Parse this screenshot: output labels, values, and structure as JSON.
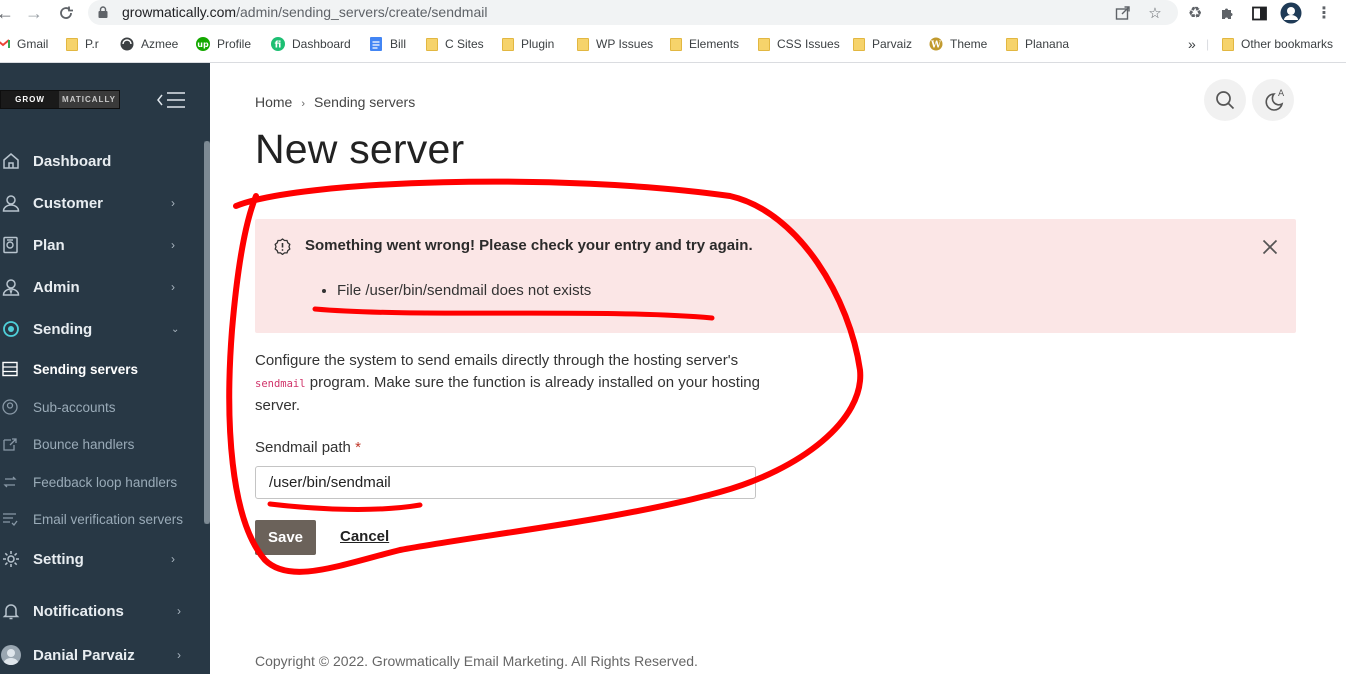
{
  "browser": {
    "url_host": "growmatically.com",
    "url_path": "/admin/sending_servers/create/sendmail",
    "bookmarks": [
      {
        "label": "Gmail",
        "icon": "gmail-icon"
      },
      {
        "label": "P.r",
        "icon": "folder-icon"
      },
      {
        "label": "Azmee",
        "icon": "globe-icon"
      },
      {
        "label": "Profile",
        "icon": "upwork-icon"
      },
      {
        "label": "Dashboard",
        "icon": "fiverr-icon"
      },
      {
        "label": "Bill",
        "icon": "docs-icon"
      },
      {
        "label": "C Sites",
        "icon": "folder-icon"
      },
      {
        "label": "Plugin",
        "icon": "folder-icon"
      },
      {
        "label": "WP Issues",
        "icon": "folder-icon"
      },
      {
        "label": "Elements",
        "icon": "folder-icon"
      },
      {
        "label": "CSS Issues",
        "icon": "folder-icon"
      },
      {
        "label": "Parvaiz",
        "icon": "folder-icon"
      },
      {
        "label": "Theme",
        "icon": "wordpress-icon"
      },
      {
        "label": "Planana",
        "icon": "folder-icon"
      }
    ],
    "overflow_label": "»",
    "other_bookmarks": "Other bookmarks"
  },
  "sidebar": {
    "logo": {
      "left": "GROW",
      "right": "MATICALLY"
    },
    "items": [
      {
        "label": "Dashboard",
        "icon": "home-icon"
      },
      {
        "label": "Customer",
        "icon": "user-icon"
      },
      {
        "label": "Plan",
        "icon": "plan-icon"
      },
      {
        "label": "Admin",
        "icon": "admin-icon"
      },
      {
        "label": "Sending",
        "icon": "sending-icon"
      },
      {
        "label": "Sending servers",
        "icon": "server-icon"
      },
      {
        "label": "Sub-accounts",
        "icon": "sub-account-icon"
      },
      {
        "label": "Bounce handlers",
        "icon": "bounce-icon"
      },
      {
        "label": "Feedback loop handlers",
        "icon": "loop-icon"
      },
      {
        "label": "Email verification servers",
        "icon": "verify-icon"
      },
      {
        "label": "Setting",
        "icon": "gear-icon"
      },
      {
        "label": "Notifications",
        "icon": "bell-icon"
      },
      {
        "label": "Danial Parvaiz",
        "icon": "avatar-icon"
      }
    ]
  },
  "main": {
    "breadcrumb": [
      "Home",
      "Sending servers"
    ],
    "title": "New server",
    "alert": {
      "title": "Something went wrong! Please check your entry and try again.",
      "errors": [
        "File /user/bin/sendmail does not exists"
      ]
    },
    "description": {
      "before": "Configure the system to send emails directly through the hosting server's ",
      "code": "sendmail",
      "after": " program. Make sure the function is already installed on your hosting server."
    },
    "field": {
      "label": "Sendmail path",
      "required_mark": "*",
      "value": "/user/bin/sendmail"
    },
    "save_label": "Save",
    "cancel_label": "Cancel",
    "footer": "Copyright © 2022. Growmatically Email Marketing. All Rights Reserved."
  },
  "colors": {
    "sidebar_bg": "#283845",
    "alert_bg": "#fbe6e6",
    "save_bg": "#6b625a",
    "annotation": "#ff0000"
  }
}
